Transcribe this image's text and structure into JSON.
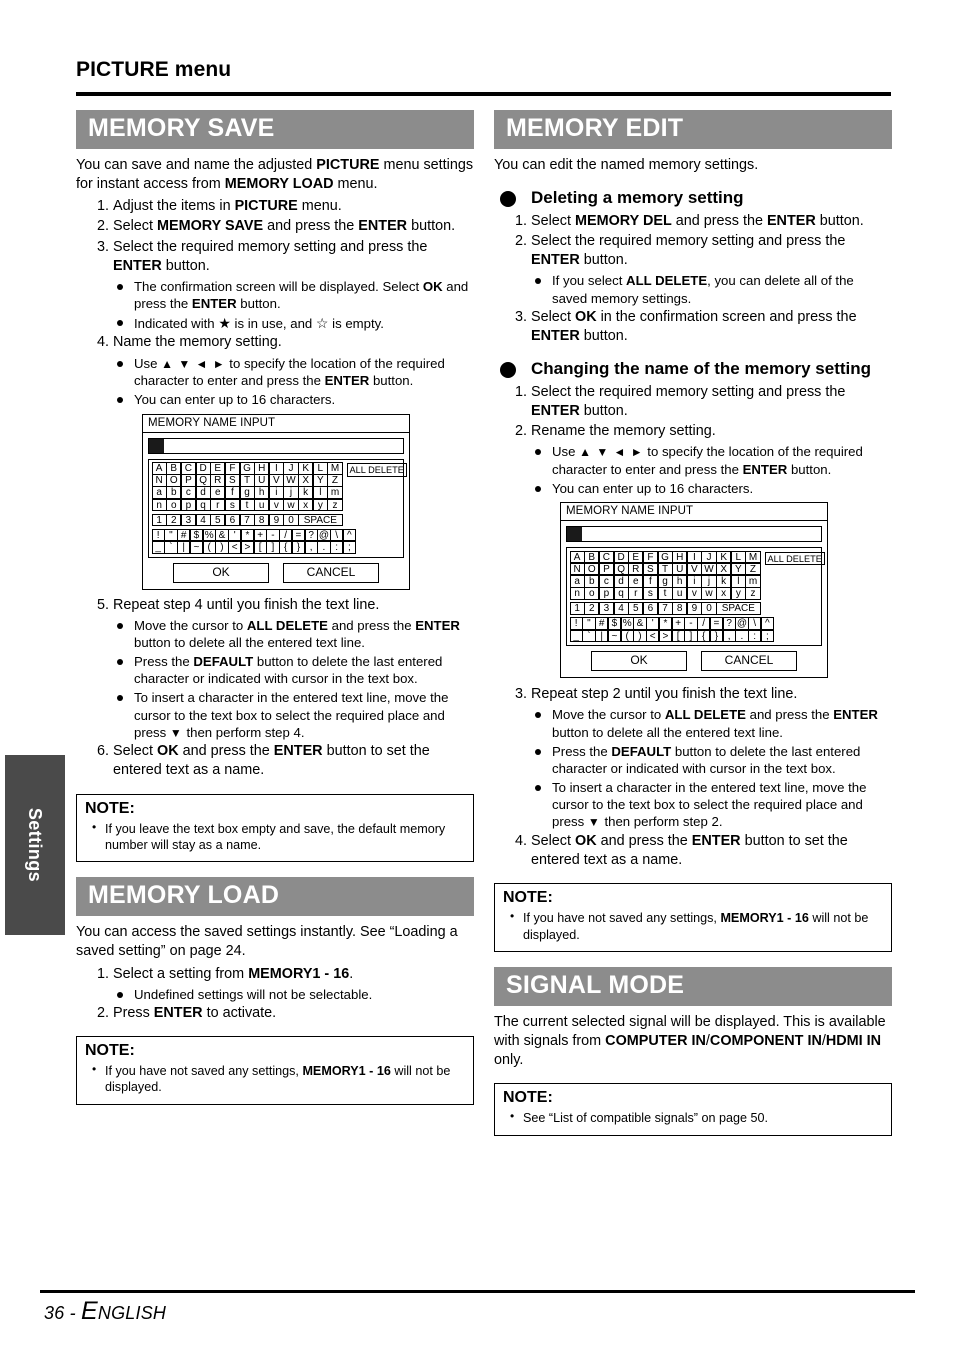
{
  "page": {
    "title": "PICTURE menu",
    "side_tab": "Settings",
    "footer_number": "36 - ",
    "footer_lang_first": "E",
    "footer_lang_rest": "NGLISH"
  },
  "colors": {
    "section_bar_bg": "#8c8c8c",
    "side_tab_bg": "#4a4a4a",
    "text": "#000000"
  },
  "keyboard": {
    "title": "MEMORY NAME INPUT",
    "all_delete": "ALL DELETE",
    "rows_alpha": [
      [
        "A",
        "B",
        "C",
        "D",
        "E",
        "F",
        "G",
        "H",
        "I",
        "J",
        "K",
        "L",
        "M"
      ],
      [
        "N",
        "O",
        "P",
        "Q",
        "R",
        "S",
        "T",
        "U",
        "V",
        "W",
        "X",
        "Y",
        "Z"
      ],
      [
        "a",
        "b",
        "c",
        "d",
        "e",
        "f",
        "g",
        "h",
        "i",
        "j",
        "k",
        "l",
        "m"
      ],
      [
        "n",
        "o",
        "p",
        "q",
        "r",
        "s",
        "t",
        "u",
        "v",
        "w",
        "x",
        "y",
        "z"
      ]
    ],
    "row_numbers": [
      "1",
      "2",
      "3",
      "4",
      "5",
      "6",
      "7",
      "8",
      "9",
      "0"
    ],
    "space_label": "SPACE",
    "rows_symbols": [
      [
        "!",
        "\"",
        "#",
        "$",
        "%",
        "&",
        "'",
        "*",
        "+",
        "-",
        "/",
        "=",
        "?",
        "@",
        "\\",
        "^"
      ],
      [
        "_",
        "`",
        "|",
        "~",
        "(",
        ")",
        "<",
        ">",
        "[",
        "]",
        "{",
        "}",
        ",",
        ".",
        ":",
        ";"
      ]
    ],
    "ok": "OK",
    "cancel": "CANCEL"
  },
  "memory_save": {
    "heading": "MEMORY SAVE",
    "intro_1": "You can save and name the adjusted ",
    "intro_b1": "PICTURE",
    "intro_2": " menu settings for instant access from ",
    "intro_b2": "MEMORY LOAD",
    "intro_3": " menu.",
    "step1_num": "1.",
    "step1_a": "Adjust the items in ",
    "step1_b": "PICTURE",
    "step1_c": " menu.",
    "step2_num": "2.",
    "step2_a": "Select ",
    "step2_b": "MEMORY SAVE",
    "step2_c": " and press the ",
    "step2_d": "ENTER",
    "step2_e": " button.",
    "step3_num": "3.",
    "step3_a": "Select the required memory setting and press the ",
    "step3_b": "ENTER",
    "step3_c": " button.",
    "step3_bullet1_a": "The confirmation screen will be displayed. Select ",
    "step3_bullet1_b": "OK",
    "step3_bullet1_c": " and press the ",
    "step3_bullet1_d": "ENTER",
    "step3_bullet1_e": " button.",
    "step3_bullet2_a": "Indicated with ",
    "step3_bullet2_star1": "★",
    "step3_bullet2_b": " is in use, and ",
    "step3_bullet2_star2": "☆",
    "step3_bullet2_c": " is empty.",
    "step4_num": "4.",
    "step4_a": "Name the memory setting.",
    "step4_bullet1_a": "Use ",
    "step4_bullet1_arrows": "▲ ▼ ◄ ►",
    "step4_bullet1_b": " to specify the location of the required character to enter and press the ",
    "step4_bullet1_c": "ENTER",
    "step4_bullet1_d": " button.",
    "step4_bullet2": "You can enter up to 16 characters.",
    "step5_num": "5.",
    "step5_a": "Repeat step 4 until you finish the text line.",
    "step5_bullet1_a": "Move the cursor to ",
    "step5_bullet1_b": "ALL DELETE",
    "step5_bullet1_c": " and press the ",
    "step5_bullet1_d": "ENTER",
    "step5_bullet1_e": " button to delete all the entered text line.",
    "step5_bullet2_a": "Press the ",
    "step5_bullet2_b": "DEFAULT",
    "step5_bullet2_c": " button to delete the last entered character or indicated with cursor in the text box.",
    "step5_bullet3_a": "To insert a character in the entered text line, move the cursor to the text box to select the required place and press ",
    "step5_bullet3_arrow": "▼",
    "step5_bullet3_b": " then perform step 4.",
    "step6_num": "6.",
    "step6_a": "Select ",
    "step6_b": "OK",
    "step6_c": " and press the ",
    "step6_d": "ENTER",
    "step6_e": " button to set the entered text as a name.",
    "note_title": "NOTE:",
    "note_item": "If you leave the text box empty and save, the default memory number will stay as a name."
  },
  "memory_load": {
    "heading": "MEMORY LOAD",
    "intro": "You can access the saved settings instantly. See “Loading a saved setting” on page 24.",
    "step1_num": "1.",
    "step1_a": "Select a setting from ",
    "step1_b": "MEMORY1 - 16",
    "step1_c": ".",
    "step1_bullet": "Undefined settings will not be selectable.",
    "step2_num": "2.",
    "step2_a": "Press ",
    "step2_b": "ENTER",
    "step2_c": " to activate.",
    "note_title": "NOTE:",
    "note_a": "If you have not saved any settings, ",
    "note_b": "MEMORY1 - 16",
    "note_c": " will not be displayed."
  },
  "memory_edit": {
    "heading": "MEMORY EDIT",
    "intro": "You can edit the named memory settings.",
    "sub1_title": "Deleting a memory setting",
    "d_step1_num": "1.",
    "d_step1_a": "Select ",
    "d_step1_b": "MEMORY DEL",
    "d_step1_c": " and press the ",
    "d_step1_d": "ENTER",
    "d_step1_e": " button.",
    "d_step2_num": "2.",
    "d_step2_a": "Select the required memory setting and press the ",
    "d_step2_b": "ENTER",
    "d_step2_c": " button.",
    "d_step2_bullet_a": "If you select ",
    "d_step2_bullet_b": "ALL DELETE",
    "d_step2_bullet_c": ", you can delete all of the saved memory settings.",
    "d_step3_num": "3.",
    "d_step3_a": "Select ",
    "d_step3_b": "OK",
    "d_step3_c": " in the confirmation screen and press the ",
    "d_step3_d": "ENTER",
    "d_step3_e": " button.",
    "sub2_title": "Changing the name of the memory setting",
    "c_step1_num": "1.",
    "c_step1_a": "Select the required memory setting and press the ",
    "c_step1_b": "ENTER",
    "c_step1_c": " button.",
    "c_step2_num": "2.",
    "c_step2_a": "Rename the memory setting.",
    "c_step2_bullet1_a": "Use ",
    "c_step2_bullet1_arrows": "▲ ▼ ◄ ►",
    "c_step2_bullet1_b": " to specify the location of the required character to enter and press the ",
    "c_step2_bullet1_c": "ENTER",
    "c_step2_bullet1_d": " button.",
    "c_step2_bullet2": "You can enter up to 16 characters.",
    "c_step3_num": "3.",
    "c_step3_a": "Repeat step 2 until you finish the text line.",
    "c_step3_bullet1_a": "Move the cursor to ",
    "c_step3_bullet1_b": "ALL DELETE",
    "c_step3_bullet1_c": " and press the ",
    "c_step3_bullet1_d": "ENTER",
    "c_step3_bullet1_e": " button to delete all the entered text line.",
    "c_step3_bullet2_a": "Press the ",
    "c_step3_bullet2_b": "DEFAULT",
    "c_step3_bullet2_c": " button to delete the last entered character or indicated with cursor in the text box.",
    "c_step3_bullet3_a": "To insert a character in the entered text line, move the cursor to the text box to select the required place and press ",
    "c_step3_bullet3_arrow": "▼",
    "c_step3_bullet3_b": " then perform step 2.",
    "c_step4_num": "4.",
    "c_step4_a": "Select ",
    "c_step4_b": "OK",
    "c_step4_c": " and press the ",
    "c_step4_d": "ENTER",
    "c_step4_e": " button to set the entered text as a name.",
    "note_title": "NOTE:",
    "note_a": "If you have not saved any settings, ",
    "note_b": "MEMORY1 - 16",
    "note_c": " will not be displayed."
  },
  "signal_mode": {
    "heading": "SIGNAL MODE",
    "intro_a": "The current selected signal will be displayed. This is available with signals from ",
    "intro_b": "COMPUTER IN",
    "intro_c": "/",
    "intro_d": "COMPONENT IN",
    "intro_e": "/",
    "intro_f": "HDMI IN",
    "intro_g": " only.",
    "note_title": "NOTE:",
    "note_item": "See “List of compatible signals” on page 50."
  }
}
